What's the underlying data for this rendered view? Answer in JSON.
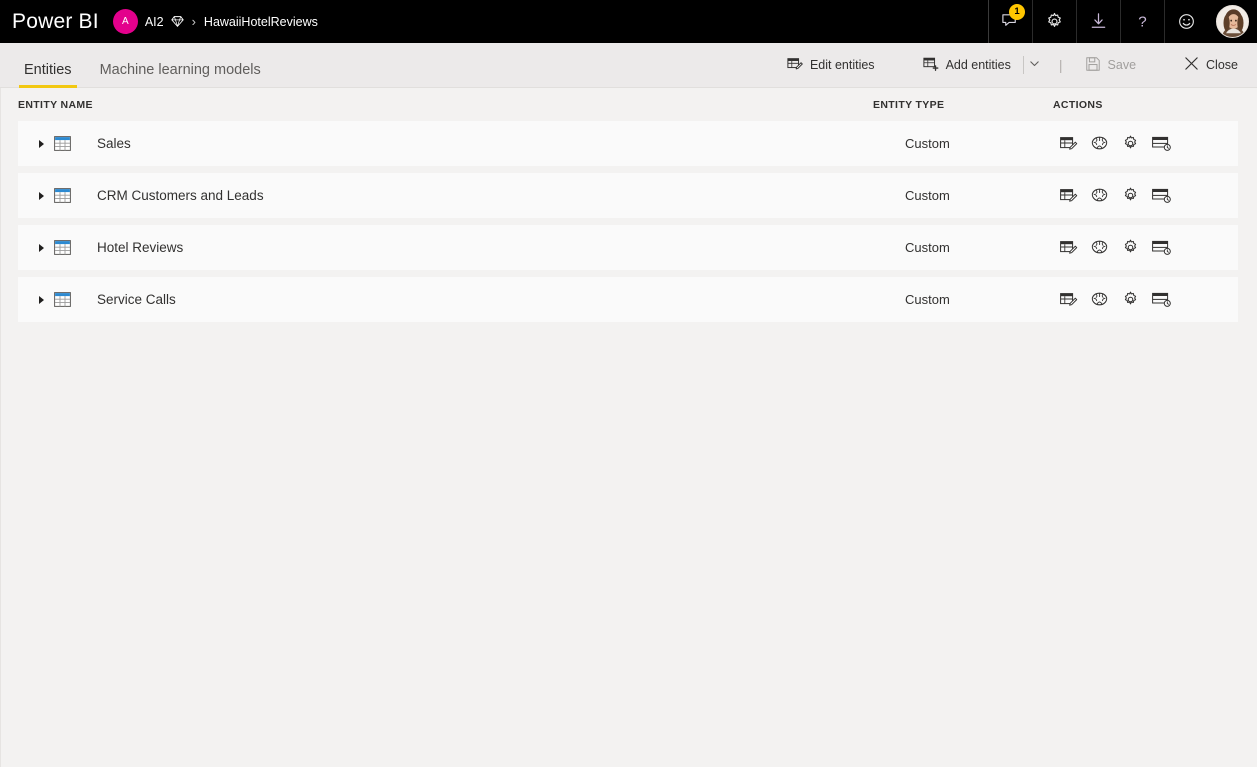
{
  "topbar": {
    "brand": "Power BI",
    "workspace_initial": "A",
    "workspace_name": "AI2",
    "premium_icon": "diamond-icon",
    "separator": "›",
    "dataflow_name": "HawaiiHotelReviews",
    "actions": [
      {
        "name": "notifications-button",
        "icon": "notification-bubble-icon",
        "badge": "1"
      },
      {
        "name": "settings-button",
        "icon": "gear-icon",
        "badge": ""
      },
      {
        "name": "download-button",
        "icon": "download-icon",
        "badge": ""
      },
      {
        "name": "help-button",
        "icon": "question-mark-icon",
        "badge": ""
      },
      {
        "name": "feedback-button",
        "icon": "smiley-icon",
        "badge": ""
      }
    ],
    "profile": {
      "name": "profile-avatar",
      "alt": "user photo"
    }
  },
  "tabs": [
    {
      "label": "Entities",
      "active": true
    },
    {
      "label": "Machine learning models",
      "active": false
    }
  ],
  "toolbar": {
    "edit_entities": "Edit entities",
    "add_entities": "Add entities",
    "add_entities_caret": "chevron-down-icon",
    "divider": "|",
    "save": "Save",
    "save_disabled": true,
    "close": "Close"
  },
  "table": {
    "columns": {
      "entity_name": "ENTITY NAME",
      "entity_type": "ENTITY TYPE",
      "actions": "ACTIONS"
    },
    "rows": [
      {
        "name": "Sales",
        "type": "Custom"
      },
      {
        "name": "CRM Customers and Leads",
        "type": "Custom"
      },
      {
        "name": "Hotel Reviews",
        "type": "Custom"
      },
      {
        "name": "Service Calls",
        "type": "Custom"
      }
    ],
    "row_actions": [
      {
        "name": "edit-entity-action",
        "icon": "table-pencil-icon"
      },
      {
        "name": "ai-insights-action",
        "icon": "brain-icon"
      },
      {
        "name": "entity-settings-action",
        "icon": "gear-icon"
      },
      {
        "name": "incremental-refresh-action",
        "icon": "table-clock-icon"
      }
    ]
  },
  "colors": {
    "brand_bar": "#000000",
    "accent_yellow": "#f2c811",
    "avatar_pink": "#e3008c",
    "badge_yellow": "#ffc600",
    "page_bg": "#f3f2f1",
    "row_bg": "#fafafa"
  }
}
